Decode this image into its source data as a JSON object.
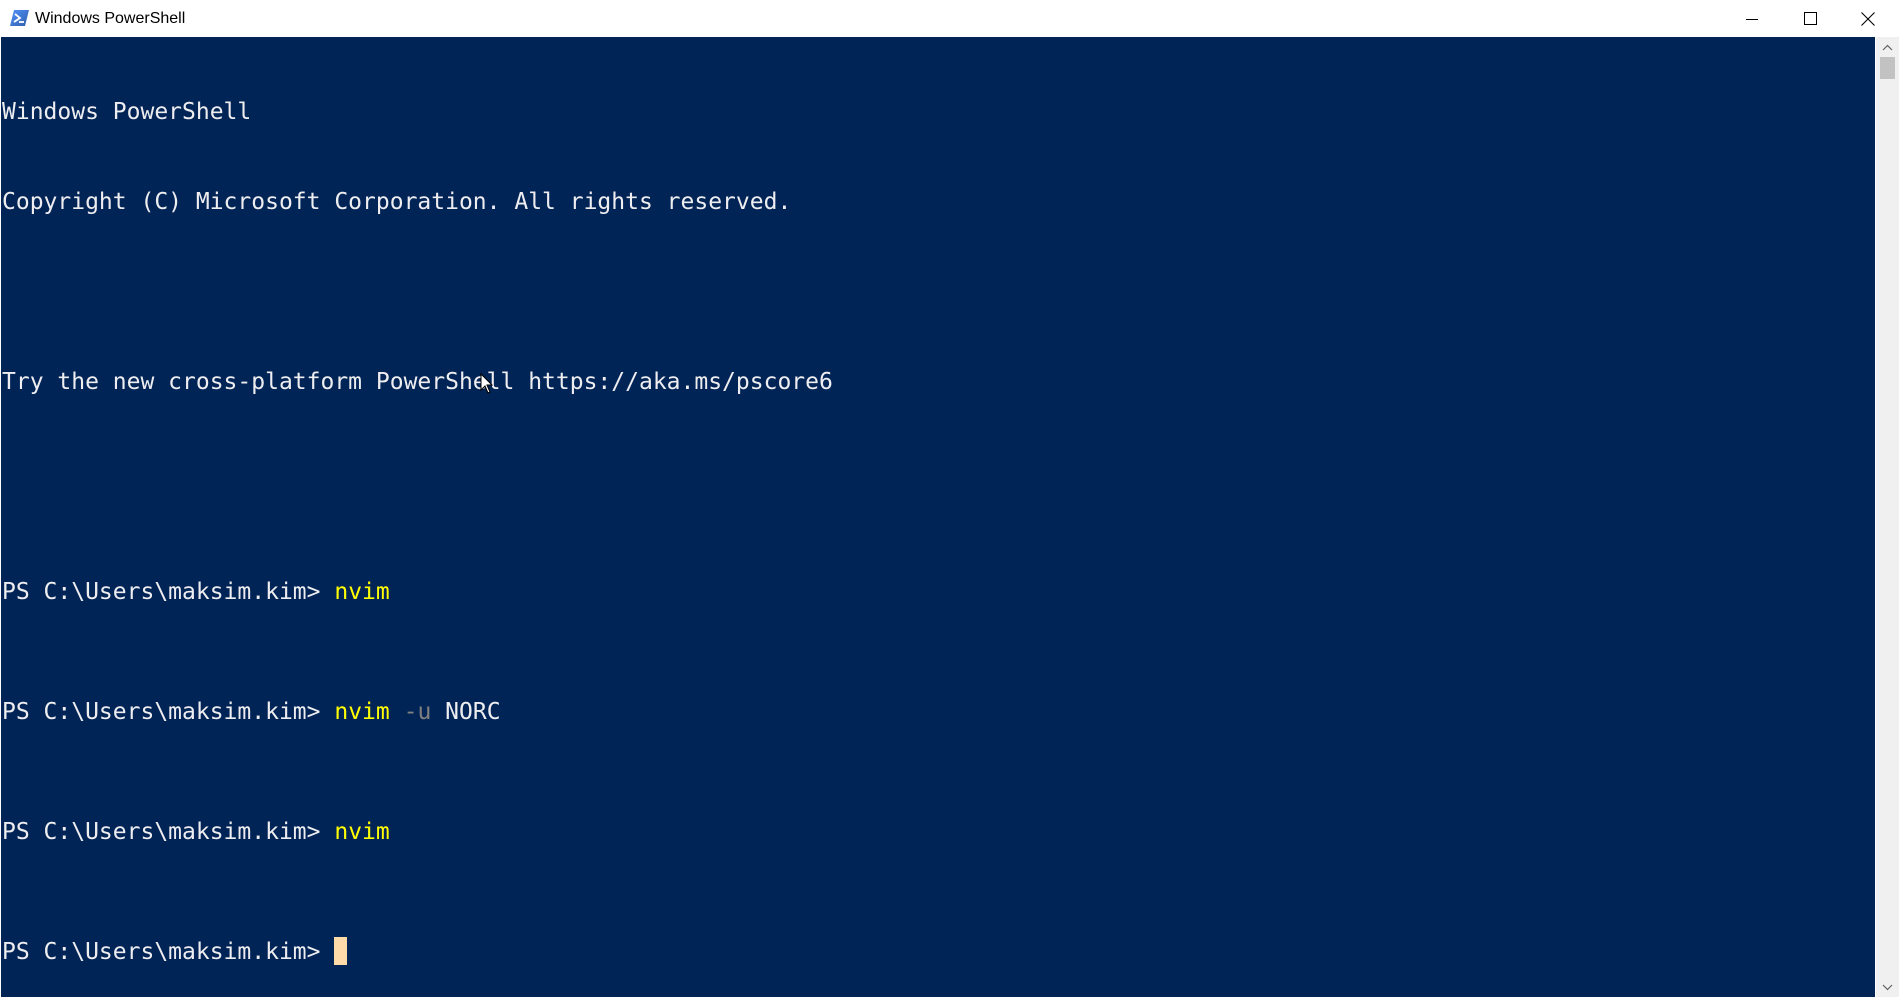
{
  "window": {
    "title": "Windows PowerShell",
    "app_icon": "powershell-icon",
    "controls": {
      "minimize": "minimize-icon",
      "maximize": "maximize-icon",
      "close": "close-icon"
    }
  },
  "console": {
    "background_color": "#012456",
    "text_color": "#eeedf0",
    "command_color": "#ffff00",
    "parameter_color": "#808080",
    "cursor_color": "#fedba9",
    "banner": {
      "line1": "Windows PowerShell",
      "line2": "Copyright (C) Microsoft Corporation. All rights reserved.",
      "line3": "Try the new cross-platform PowerShell https://aka.ms/pscore6"
    },
    "history": [
      {
        "prompt": "PS C:\\Users\\maksim.kim> ",
        "command": "nvim",
        "parameter": "",
        "argument": ""
      },
      {
        "prompt": "PS C:\\Users\\maksim.kim> ",
        "command": "nvim",
        "parameter": "-u",
        "argument": "NORC"
      },
      {
        "prompt": "PS C:\\Users\\maksim.kim> ",
        "command": "nvim",
        "parameter": "",
        "argument": ""
      }
    ],
    "current_prompt": "PS C:\\Users\\maksim.kim> "
  },
  "scrollbar": {
    "up_icon": "scroll-up-arrow-icon",
    "down_icon": "scroll-down-arrow-icon"
  }
}
